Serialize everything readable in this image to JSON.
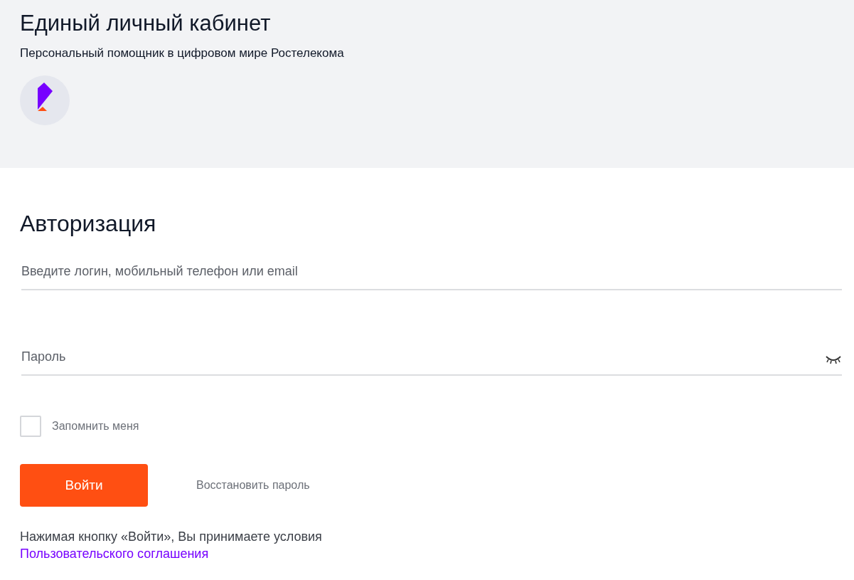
{
  "header": {
    "title": "Единый личный кабинет",
    "subtitle": "Персональный помощник в цифровом мире Ростелекома"
  },
  "form": {
    "title": "Авторизация",
    "fields": [
      {
        "kind": "text",
        "placeholder": "Введите логин, мобильный телефон или email"
      },
      {
        "kind": "password",
        "placeholder": "Пароль",
        "password_visible": false
      }
    ],
    "remember": {
      "label": "Запомнить меня",
      "checked": false
    },
    "submit": "Войти",
    "restore": "Восстановить пароль",
    "terms": {
      "text": "Нажимая кнопку «Войти», Вы принимаете условия",
      "link": "Пользовательского соглашения"
    }
  }
}
